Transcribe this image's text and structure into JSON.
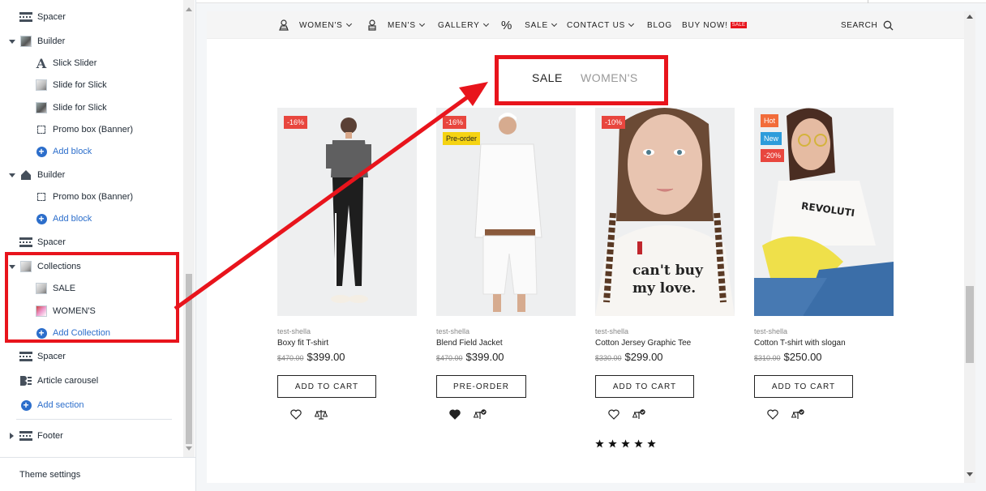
{
  "sidebar": {
    "items": [
      {
        "label": "Spacer"
      },
      {
        "label": "Builder"
      },
      {
        "label": "Slick Slider"
      },
      {
        "label": "Slide for Slick"
      },
      {
        "label": "Slide for Slick"
      },
      {
        "label": "Promo box (Banner)"
      },
      {
        "label": "Add block"
      },
      {
        "label": "Builder"
      },
      {
        "label": "Promo box (Banner)"
      },
      {
        "label": "Add block"
      },
      {
        "label": "Spacer"
      },
      {
        "label": "Collections"
      },
      {
        "label": "SALE"
      },
      {
        "label": "WOMEN'S"
      },
      {
        "label": "Add Collection"
      },
      {
        "label": "Spacer"
      },
      {
        "label": "Article carousel"
      },
      {
        "label": "Add section"
      },
      {
        "label": "Footer"
      }
    ],
    "theme_settings": "Theme settings"
  },
  "nav": {
    "items": [
      "WOMEN'S",
      "MEN'S",
      "GALLERY",
      "SALE",
      "CONTACT US",
      "BLOG",
      "BUY NOW!"
    ],
    "sale_tag": "SALE",
    "search": "SEARCH"
  },
  "tabs": {
    "active": "SALE",
    "inactive": "WOMEN'S"
  },
  "products": [
    {
      "discount": "-16%",
      "vendor": "test-shella",
      "name": "Boxy fit T-shirt",
      "old_price": "$470.00",
      "price": "$399.00",
      "button": "ADD TO CART"
    },
    {
      "discount": "-16%",
      "preorder": "Pre-order",
      "vendor": "test-shella",
      "name": "Blend Field Jacket",
      "old_price": "$470.00",
      "price": "$399.00",
      "button": "PRE-ORDER"
    },
    {
      "discount": "-10%",
      "vendor": "test-shella",
      "name": "Cotton Jersey Graphic Tee",
      "old_price": "$330.00",
      "price": "$299.00",
      "button": "ADD TO CART",
      "rating": 5
    },
    {
      "hot": "Hot",
      "new": "New",
      "discount": "-20%",
      "vendor": "test-shella",
      "name": "Cotton T-shirt with slogan",
      "old_price": "$310.00",
      "price": "$250.00",
      "button": "ADD TO CART"
    }
  ],
  "tee_print": [
    "can't buy",
    "my love."
  ],
  "colors": {
    "highlight": "#e8141c",
    "link_blue": "#2c6ecb",
    "badge_red": "#e8463e",
    "badge_yellow": "#f5d312"
  }
}
